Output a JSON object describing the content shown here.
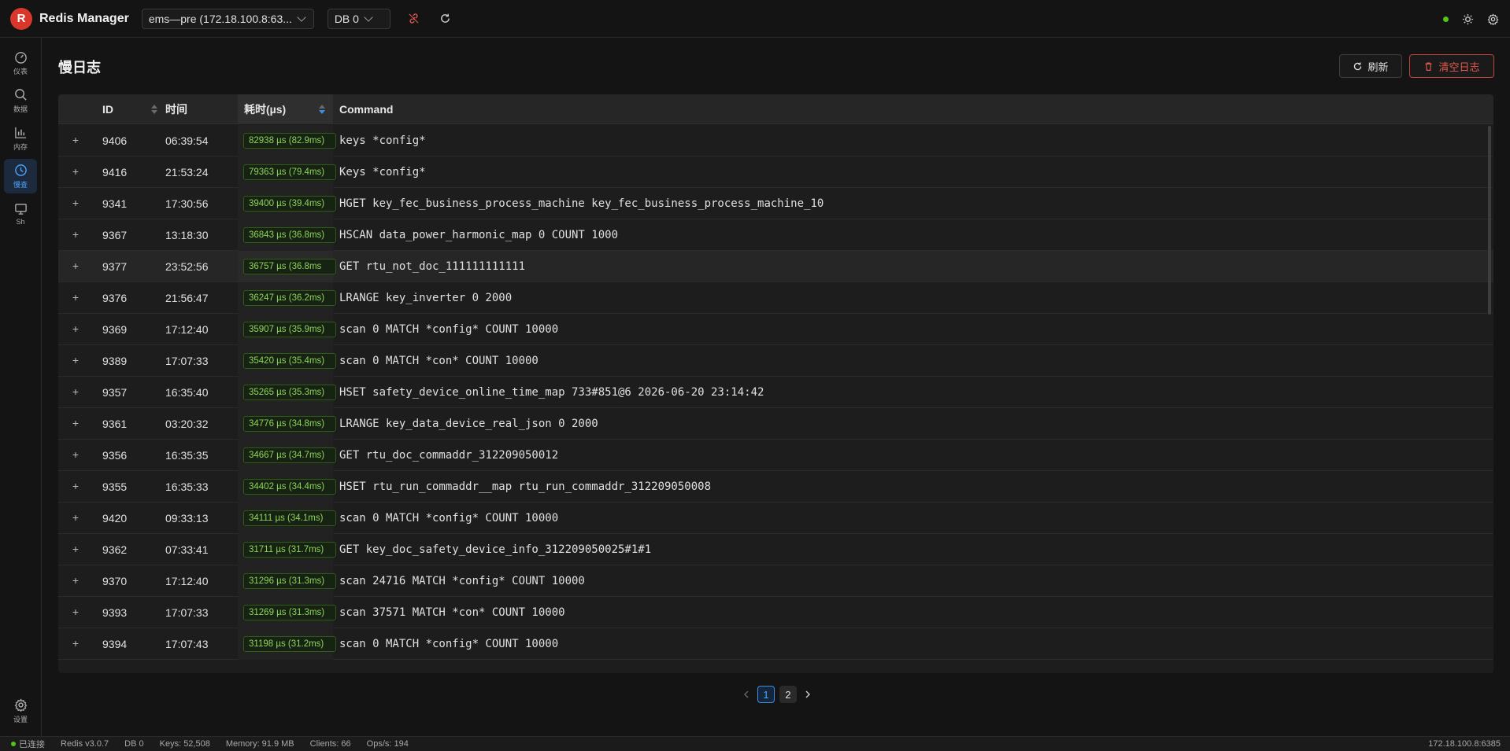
{
  "header": {
    "logo_letter": "R",
    "app_title": "Redis Manager",
    "connection": "ems—pre (172.18.100.8:63...",
    "db": "DB 0"
  },
  "sidebar": {
    "items": [
      {
        "label": "仪表",
        "icon": "dashboard-icon"
      },
      {
        "label": "数据",
        "icon": "search-icon"
      },
      {
        "label": "内存",
        "icon": "bar-chart-icon"
      },
      {
        "label": "慢查",
        "icon": "clock-icon"
      },
      {
        "label": "Sh",
        "icon": "monitor-icon"
      }
    ],
    "settings_label": "设置"
  },
  "page": {
    "title": "慢日志",
    "refresh_label": "刷新",
    "clear_label": "清空日志"
  },
  "table": {
    "columns": [
      "ID",
      "时间",
      "耗时(µs)",
      "Command"
    ],
    "rows": [
      {
        "id": "9406",
        "time": "06:39:54",
        "duration": "82938 µs (82.9ms)",
        "command": "keys *config*"
      },
      {
        "id": "9416",
        "time": "21:53:24",
        "duration": "79363 µs (79.4ms)",
        "command": "Keys *config*"
      },
      {
        "id": "9341",
        "time": "17:30:56",
        "duration": "39400 µs (39.4ms)",
        "command": "HGET key_fec_business_process_machine key_fec_business_process_machine_10"
      },
      {
        "id": "9367",
        "time": "13:18:30",
        "duration": "36843 µs (36.8ms)",
        "command": "HSCAN data_power_harmonic_map 0 COUNT 1000"
      },
      {
        "id": "9377",
        "time": "23:52:56",
        "duration": "36757 µs (36.8ms",
        "command": "GET rtu_not_doc_111111111111"
      },
      {
        "id": "9376",
        "time": "21:56:47",
        "duration": "36247 µs (36.2ms)",
        "command": "LRANGE key_inverter 0 2000"
      },
      {
        "id": "9369",
        "time": "17:12:40",
        "duration": "35907 µs (35.9ms)",
        "command": "scan 0 MATCH *config* COUNT 10000"
      },
      {
        "id": "9389",
        "time": "17:07:33",
        "duration": "35420 µs (35.4ms)",
        "command": "scan 0 MATCH *con* COUNT 10000"
      },
      {
        "id": "9357",
        "time": "16:35:40",
        "duration": "35265 µs (35.3ms)",
        "command": "HSET safety_device_online_time_map 733#851@6 2026-06-20 23:14:42"
      },
      {
        "id": "9361",
        "time": "03:20:32",
        "duration": "34776 µs (34.8ms)",
        "command": "LRANGE key_data_device_real_json 0 2000"
      },
      {
        "id": "9356",
        "time": "16:35:35",
        "duration": "34667 µs (34.7ms)",
        "command": "GET rtu_doc_commaddr_312209050012"
      },
      {
        "id": "9355",
        "time": "16:35:33",
        "duration": "34402 µs (34.4ms)",
        "command": "HSET rtu_run_commaddr__map rtu_run_commaddr_312209050008"
      },
      {
        "id": "9420",
        "time": "09:33:13",
        "duration": "34111 µs (34.1ms)",
        "command": "scan 0 MATCH *config* COUNT 10000"
      },
      {
        "id": "9362",
        "time": "07:33:41",
        "duration": "31711 µs (31.7ms)",
        "command": "GET key_doc_safety_device_info_312209050025#1#1"
      },
      {
        "id": "9370",
        "time": "17:12:40",
        "duration": "31296 µs (31.3ms)",
        "command": "scan 24716 MATCH *config* COUNT 10000"
      },
      {
        "id": "9393",
        "time": "17:07:33",
        "duration": "31269 µs (31.3ms)",
        "command": "scan 37571 MATCH *con* COUNT 10000"
      },
      {
        "id": "9394",
        "time": "17:07:43",
        "duration": "31198 µs (31.2ms)",
        "command": "scan 0 MATCH *config* COUNT 10000"
      }
    ]
  },
  "pagination": {
    "pages": [
      "1",
      "2"
    ],
    "current": "1"
  },
  "statusbar": {
    "connection": "已连接",
    "version": "Redis v3.0.7",
    "db": "DB 0",
    "keys": "Keys: 52,508",
    "memory": "Memory: 91.9 MB",
    "clients": "Clients: 66",
    "ops": "Ops/s: 194",
    "host": "172.18.100.8:6385"
  },
  "colors": {
    "accent": "#3a8ee6",
    "danger": "#e5584d",
    "success": "#52c41a",
    "tag_text": "#8fd35a"
  }
}
